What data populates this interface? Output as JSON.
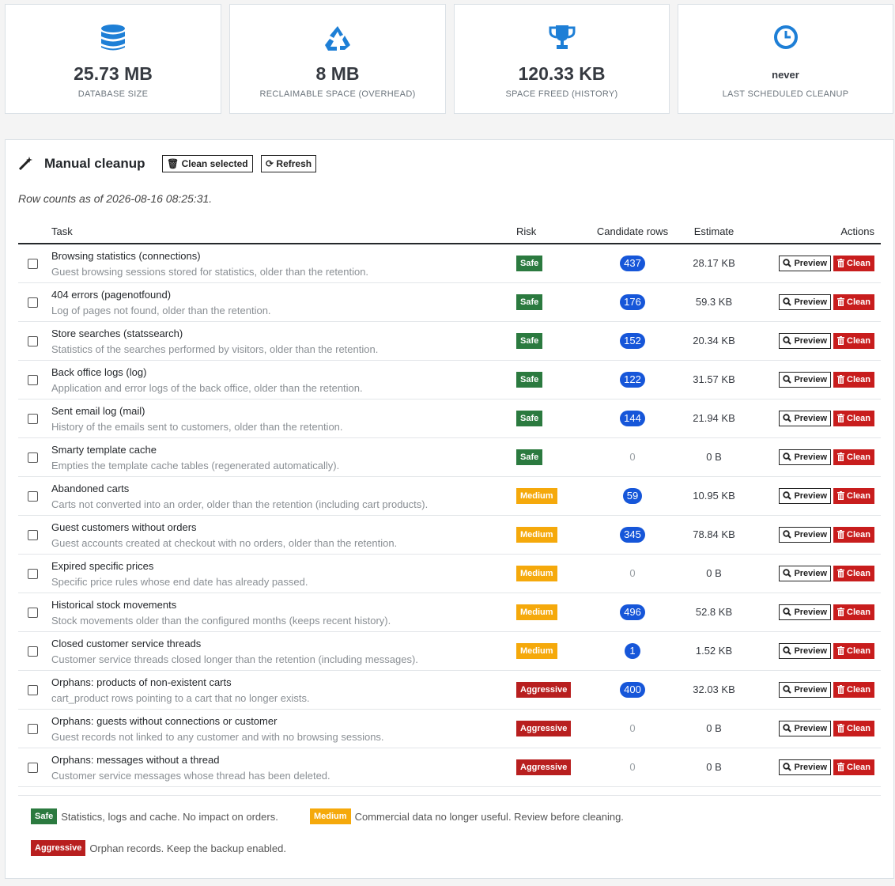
{
  "kpis": [
    {
      "icon": "database-icon",
      "value": "25.73 MB",
      "label": "DATABASE SIZE"
    },
    {
      "icon": "recycle-icon",
      "value": "8 MB",
      "label": "RECLAIMABLE SPACE (OVERHEAD)"
    },
    {
      "icon": "trophy-icon",
      "value": "120.33 KB",
      "label": "SPACE FREED (HISTORY)"
    },
    {
      "icon": "clock-icon",
      "value": "never",
      "label": "LAST SCHEDULED CLEANUP"
    }
  ],
  "panel": {
    "title": "Manual cleanup",
    "clean_selected_label": "Clean selected",
    "refresh_label": "Refresh",
    "as_of": "Row counts as of 2026-08-16 08:25:31."
  },
  "columns": {
    "task": "Task",
    "risk": "Risk",
    "candidates": "Candidate rows",
    "estimate": "Estimate",
    "actions": "Actions"
  },
  "action_labels": {
    "preview": "Preview",
    "clean": "Clean"
  },
  "tasks": [
    {
      "name": "Browsing statistics (connections)",
      "desc": "Guest browsing sessions stored for statistics, older than the retention.",
      "risk": "Safe",
      "count": "437",
      "estimate": "28.17 KB"
    },
    {
      "name": "404 errors (pagenotfound)",
      "desc": "Log of pages not found, older than the retention.",
      "risk": "Safe",
      "count": "176",
      "estimate": "59.3 KB"
    },
    {
      "name": "Store searches (statssearch)",
      "desc": "Statistics of the searches performed by visitors, older than the retention.",
      "risk": "Safe",
      "count": "152",
      "estimate": "20.34 KB"
    },
    {
      "name": "Back office logs (log)",
      "desc": "Application and error logs of the back office, older than the retention.",
      "risk": "Safe",
      "count": "122",
      "estimate": "31.57 KB"
    },
    {
      "name": "Sent email log (mail)",
      "desc": "History of the emails sent to customers, older than the retention.",
      "risk": "Safe",
      "count": "144",
      "estimate": "21.94 KB"
    },
    {
      "name": "Smarty template cache",
      "desc": "Empties the template cache tables (regenerated automatically).",
      "risk": "Safe",
      "count": "0",
      "estimate": "0 B"
    },
    {
      "name": "Abandoned carts",
      "desc": "Carts not converted into an order, older than the retention (including cart products).",
      "risk": "Medium",
      "count": "59",
      "estimate": "10.95 KB"
    },
    {
      "name": "Guest customers without orders",
      "desc": "Guest accounts created at checkout with no orders, older than the retention.",
      "risk": "Medium",
      "count": "345",
      "estimate": "78.84 KB"
    },
    {
      "name": "Expired specific prices",
      "desc": "Specific price rules whose end date has already passed.",
      "risk": "Medium",
      "count": "0",
      "estimate": "0 B"
    },
    {
      "name": "Historical stock movements",
      "desc": "Stock movements older than the configured months (keeps recent history).",
      "risk": "Medium",
      "count": "496",
      "estimate": "52.8 KB"
    },
    {
      "name": "Closed customer service threads",
      "desc": "Customer service threads closed longer than the retention (including messages).",
      "risk": "Medium",
      "count": "1",
      "estimate": "1.52 KB"
    },
    {
      "name": "Orphans: products of non-existent carts",
      "desc": "cart_product rows pointing to a cart that no longer exists.",
      "risk": "Aggressive",
      "count": "400",
      "estimate": "32.03 KB"
    },
    {
      "name": "Orphans: guests without connections or customer",
      "desc": "Guest records not linked to any customer and with no browsing sessions.",
      "risk": "Aggressive",
      "count": "0",
      "estimate": "0 B"
    },
    {
      "name": "Orphans: messages without a thread",
      "desc": "Customer service messages whose thread has been deleted.",
      "risk": "Aggressive",
      "count": "0",
      "estimate": "0 B"
    }
  ],
  "legend": [
    {
      "risk": "Safe",
      "text": "Statistics, logs and cache. No impact on orders."
    },
    {
      "risk": "Medium",
      "text": "Commercial data no longer useful. Review before cleaning."
    },
    {
      "risk": "Aggressive",
      "text": "Orphan records. Keep the backup enabled."
    }
  ],
  "colors": {
    "safe": "#2b7a3f",
    "medium": "#f5a90b",
    "aggressive": "#b81f1f",
    "count_pill": "#1656d9",
    "icon_blue": "#1e7fd6",
    "clean_button": "#c81d1d"
  }
}
